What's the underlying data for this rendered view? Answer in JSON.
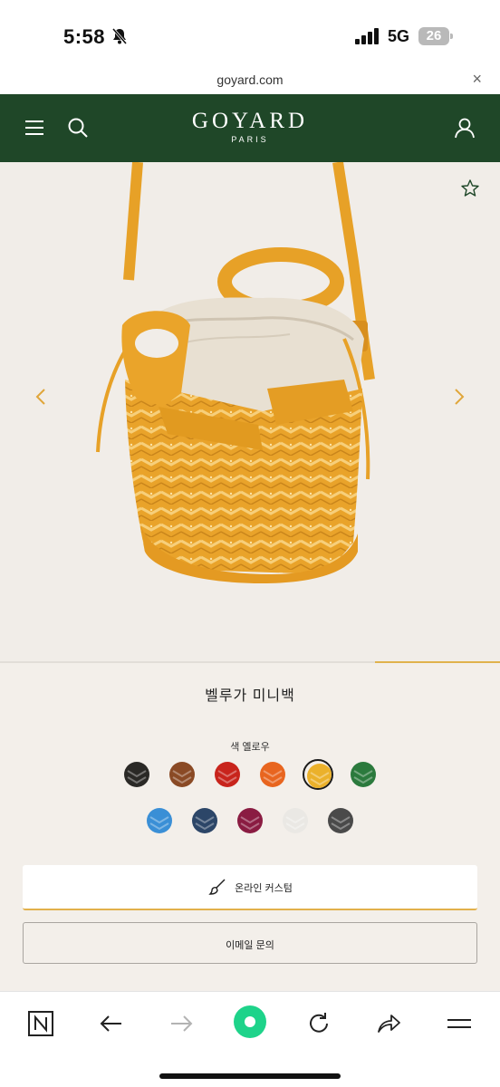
{
  "status_bar": {
    "time": "5:58",
    "network": "5G",
    "battery": "26"
  },
  "url_bar": {
    "url": "goyard.com",
    "close": "×"
  },
  "header": {
    "logo": "GOYARD",
    "logo_sub": "PARIS"
  },
  "gallery": {
    "current_slide_progress": 0.25
  },
  "product": {
    "title": "벨루가 미니백",
    "color_label": "색 옐로우"
  },
  "swatches": [
    {
      "color": "#2a2926",
      "selected": false
    },
    {
      "color": "#8a4a25",
      "selected": false
    },
    {
      "color": "#c8241c",
      "selected": false
    },
    {
      "color": "#e8651f",
      "selected": false
    },
    {
      "color": "#ebb12b",
      "selected": true
    },
    {
      "color": "#2b7a3d",
      "selected": false
    },
    {
      "color": "#3a8fd6",
      "selected": false
    },
    {
      "color": "#2c4668",
      "selected": false
    },
    {
      "color": "#8a1c42",
      "selected": false
    },
    {
      "color": "#eae8e4",
      "selected": false
    },
    {
      "color": "#4a4a4a",
      "selected": false
    }
  ],
  "actions": {
    "custom_label": "온라인 커스텀",
    "email_label": "이메일 문의"
  },
  "colors": {
    "header_green": "#1f4728",
    "accent_yellow": "#e2b04a"
  }
}
